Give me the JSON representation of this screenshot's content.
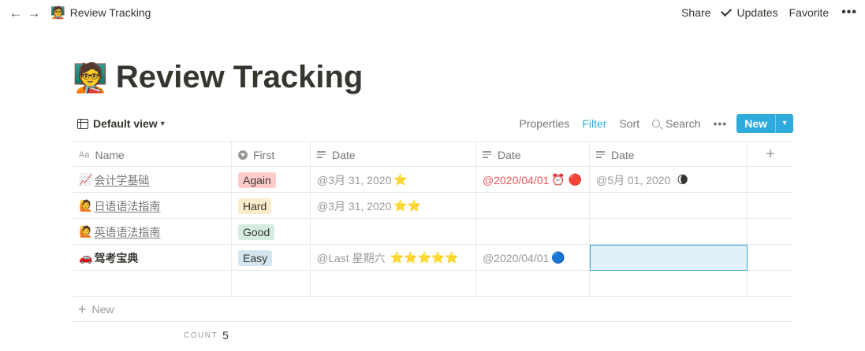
{
  "topbar": {
    "back": "←",
    "forward": "→",
    "page_emoji": "🧑‍🏫",
    "page_title": "Review Tracking",
    "share": "Share",
    "updates": "Updates",
    "favorite": "Favorite",
    "more": "•••"
  },
  "title": {
    "emoji": "🧑‍🏫",
    "text": "Review Tracking"
  },
  "viewbar": {
    "view_name": "Default view",
    "properties": "Properties",
    "filter": "Filter",
    "sort": "Sort",
    "search": "Search",
    "more": "•••",
    "new": "New",
    "new_dropdown": "▾"
  },
  "columns": [
    "Name",
    "First",
    "Date",
    "Date",
    "Date"
  ],
  "column_icons": [
    "text-icon",
    "select-icon",
    "date-icon",
    "date-icon",
    "date-icon"
  ],
  "add_column": "+",
  "rows": [
    {
      "name_emoji": "📈",
      "name": "会计学基础",
      "first": "Again",
      "first_color": "#ffcccc",
      "date1": "@3月 31, 2020",
      "date1_emoji": "⭐",
      "date2": "@2020/04/01",
      "date2_emoji": "⏰ 🔴",
      "date3": "@5月 01, 2020",
      "date3_emoji": "🌘"
    },
    {
      "name_emoji": "🙋",
      "name": "日语语法指南",
      "first": "Hard",
      "first_color": "#fbecca",
      "date1": "@3月 31, 2020",
      "date1_emoji": "⭐⭐",
      "date2": "",
      "date2_emoji": "",
      "date3": "",
      "date3_emoji": ""
    },
    {
      "name_emoji": "🙋",
      "name": "英语语法指南",
      "first": "Good",
      "first_color": "#d6ecde",
      "date1": "",
      "date1_emoji": "",
      "date2": "",
      "date2_emoji": "",
      "date3": "",
      "date3_emoji": ""
    },
    {
      "name_emoji": "🚗",
      "name": "驾考宝典",
      "first": "Easy",
      "first_color": "#d3e5ef",
      "date1": "@Last 星期六",
      "date1_emoji": "⭐⭐⭐⭐⭐",
      "date2": "@2020/04/01",
      "date2_emoji": "🔵",
      "date3": "",
      "date3_emoji": ""
    }
  ],
  "new_row": {
    "plus": "+",
    "label": "New"
  },
  "count": {
    "label": "COUNT",
    "value": "5"
  },
  "colors": {
    "accent": "#2eaadc",
    "text": "#37352f",
    "muted": "#9b9a97",
    "red": "#eb5757"
  }
}
